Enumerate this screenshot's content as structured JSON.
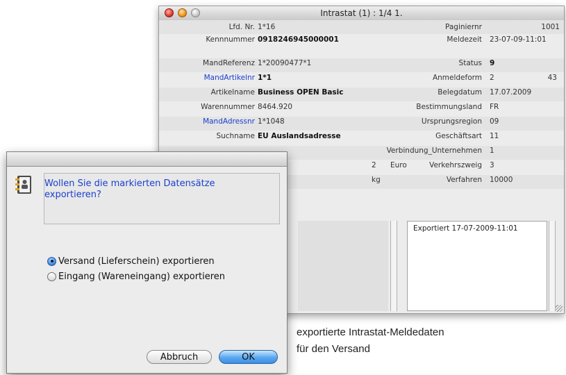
{
  "window": {
    "title": "Intrastat (1) : 1/4 1.",
    "left": [
      {
        "label": "Lfd. Nr.",
        "value": "1*16",
        "bold": false,
        "link": false
      },
      {
        "label": "Kennnummer",
        "value": "0918246945000001",
        "bold": true,
        "link": false
      },
      {
        "label": "MandReferenz",
        "value": "1*20090477*1",
        "bold": false,
        "link": false
      },
      {
        "label": "MandArtikelnr",
        "value": "1*1",
        "bold": true,
        "link": true
      },
      {
        "label": "Artikelname",
        "value": "Business OPEN Basic",
        "bold": true,
        "link": false
      },
      {
        "label": "Warennummer",
        "value": "8464.920",
        "bold": false,
        "link": false
      },
      {
        "label": "MandAdressnr",
        "value": "1*1048",
        "bold": false,
        "link": true
      },
      {
        "label": "Suchname",
        "value": "EU Auslandsadresse",
        "bold": true,
        "link": false
      }
    ],
    "right": [
      {
        "label": "Paginiernr",
        "value": "",
        "extra": "1001"
      },
      {
        "label": "Meldezeit",
        "value": "23-07-09-11:01",
        "extra": ""
      },
      {
        "label": "Status",
        "value": "9",
        "extra": ""
      },
      {
        "label": "Anmeldeform",
        "value": "2",
        "extra": "43"
      },
      {
        "label": "Belegdatum",
        "value": "17.07.2009",
        "extra": ""
      },
      {
        "label": "Bestimmungsland",
        "value": "FR",
        "extra": ""
      },
      {
        "label": "Ursprungsregion",
        "value": "09",
        "extra": ""
      },
      {
        "label": "Geschäftsart",
        "value": "11",
        "extra": ""
      },
      {
        "label": "Verbindung_Unternehmen",
        "value": "1",
        "extra": ""
      },
      {
        "label": "Verkehrszweig",
        "value": "3",
        "extra": ""
      },
      {
        "label": "Verfahren",
        "value": "10000",
        "extra": ""
      }
    ],
    "mid": {
      "amount": "2",
      "currency": "Euro",
      "unit": "kg"
    },
    "export_note": "Exportiert 17-07-2009-11:01"
  },
  "dialog": {
    "message": "Wollen Sie die markierten Datensätze exportieren?",
    "options": [
      {
        "label": "Versand (Lieferschein) exportieren",
        "selected": true
      },
      {
        "label": "Eingang (Wareneingang) exportieren",
        "selected": false
      }
    ],
    "cancel_label": "Abbruch",
    "ok_label": "OK"
  },
  "caption": {
    "line1": "exportierte Intrastat-Meldedaten",
    "line2": "für den Versand"
  },
  "colors": {
    "link_blue": "#1a3fd1",
    "default_button": "#5aa7ef"
  }
}
